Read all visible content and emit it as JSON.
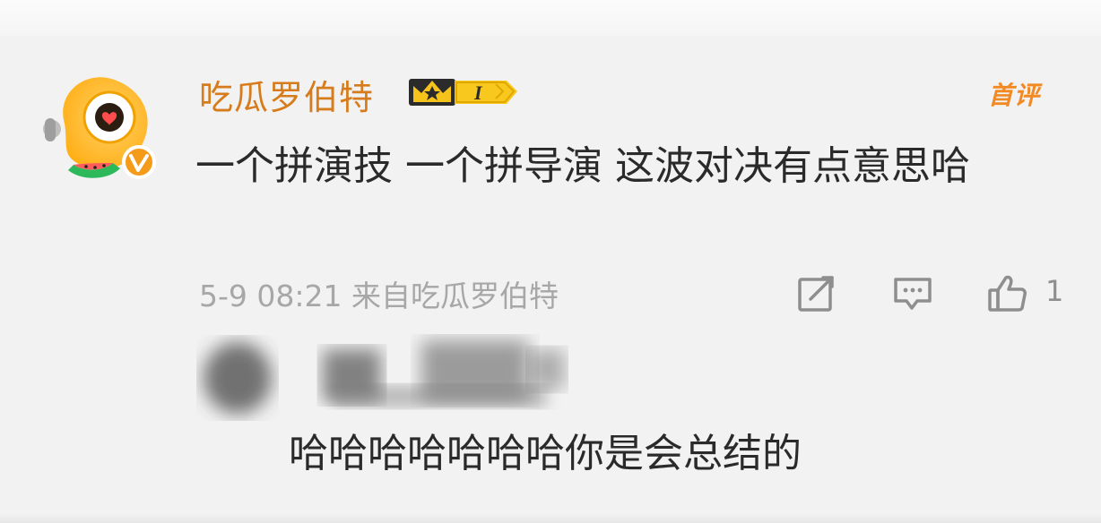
{
  "comment": {
    "author": "吃瓜罗伯特",
    "level_badge": "I",
    "first_comment_tag": "首评",
    "text": "一个拼演技 一个拼导演 这波对决有点意思哈",
    "timestamp": "5-9 08:21",
    "source": "来自吃瓜罗伯特",
    "likes": "1"
  },
  "reply": {
    "text": "哈哈哈哈哈哈哈你是会总结的"
  },
  "icons": {
    "repost": "repost-icon",
    "comment": "comment-icon",
    "like": "like-icon",
    "verified": "verified-v-icon",
    "crown": "crown-icon"
  },
  "colors": {
    "username": "#d77c1c",
    "first_comment": "#f18a22",
    "meta": "#a7a7a7",
    "text": "#2a2a2a"
  }
}
